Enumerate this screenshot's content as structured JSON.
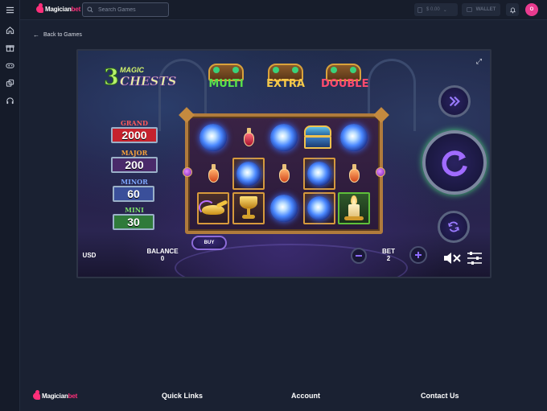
{
  "app": {
    "logo_text_a": "Magician",
    "logo_text_b": "bet"
  },
  "sidebar": {
    "items": [
      {
        "name": "menu"
      },
      {
        "name": "home"
      },
      {
        "name": "gift"
      },
      {
        "name": "games"
      },
      {
        "name": "casino"
      },
      {
        "name": "support"
      }
    ]
  },
  "header": {
    "search_placeholder": "Search Games",
    "balance": "$ 0.00",
    "wallet_label": "WALLET",
    "avatar_initial": "O"
  },
  "nav": {
    "back_label": "Back to Games"
  },
  "game": {
    "title_num": "3",
    "title_line1": "MAGIC",
    "title_line2": "CHESTS",
    "chests": [
      {
        "label": "MULTI",
        "color": "#59e04a"
      },
      {
        "label": "EXTRA",
        "color": "#f5c94a"
      },
      {
        "label": "DOUBLE",
        "color": "#ff4b6e"
      }
    ],
    "jackpots": [
      {
        "label": "GRAND",
        "value": "2000",
        "label_color": "#ff5a5a",
        "box_color": "#c5222d"
      },
      {
        "label": "MAJOR",
        "value": "200",
        "label_color": "#f6a13a",
        "box_color": "#4a2a6a"
      },
      {
        "label": "MINOR",
        "value": "60",
        "label_color": "#7ea7ff",
        "box_color": "#3a4f9a"
      },
      {
        "label": "MINI",
        "value": "30",
        "label_color": "#7be06a",
        "box_color": "#2f7a3a"
      }
    ],
    "reels": [
      [
        "orb",
        "potion-red",
        "orb",
        "treasure",
        "orb"
      ],
      [
        "potion",
        "orb-gold",
        "potion",
        "orb-gold",
        "potion"
      ],
      [
        "lamp-gold",
        "chalice-gold",
        "orb",
        "orb-gold",
        "candle-green"
      ]
    ],
    "hud": {
      "currency": "USD",
      "balance_label": "BALANCE",
      "balance_value": "0",
      "buy_label": "BUY",
      "bet_label": "BET",
      "bet_value": "2"
    }
  },
  "footer": {
    "quick_links": "Quick Links",
    "account": "Account",
    "contact": "Contact Us"
  }
}
